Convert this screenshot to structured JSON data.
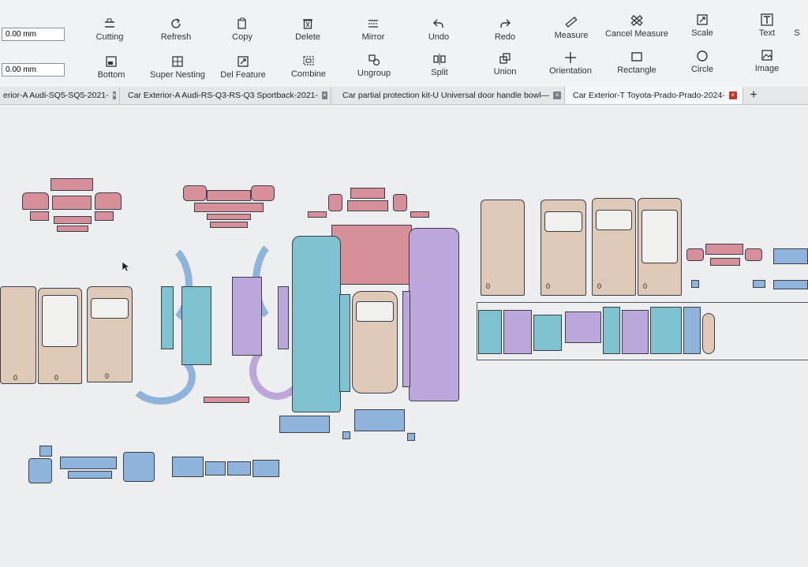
{
  "inputs": [
    {
      "value": "0.00 mm"
    },
    {
      "value": "0.00 mm"
    }
  ],
  "toolbar": {
    "row1": [
      {
        "label": "Cutting",
        "icon": "cutting-icon"
      },
      {
        "label": "Refresh",
        "icon": "refresh-icon"
      },
      {
        "label": "Copy",
        "icon": "copy-icon"
      },
      {
        "label": "Delete",
        "icon": "delete-icon"
      },
      {
        "label": "Mirror",
        "icon": "mirror-icon"
      },
      {
        "label": "Undo",
        "icon": "undo-icon"
      },
      {
        "label": "Redo",
        "icon": "redo-icon"
      },
      {
        "label": "Measure",
        "icon": "measure-icon"
      },
      {
        "label": "Cancel Measure",
        "icon": "cancel-measure-icon"
      },
      {
        "label": "Scale",
        "icon": "scale-icon"
      },
      {
        "label": "Text",
        "icon": "text-icon"
      },
      {
        "label": "S",
        "icon": ""
      }
    ],
    "row2": [
      {
        "label": "Bottom",
        "icon": "bottom-icon"
      },
      {
        "label": "Super Nesting",
        "icon": "super-nesting-icon"
      },
      {
        "label": "Del Feature",
        "icon": "del-feature-icon"
      },
      {
        "label": "Combine",
        "icon": "combine-icon"
      },
      {
        "label": "Ungroup",
        "icon": "ungroup-icon"
      },
      {
        "label": "Split",
        "icon": "split-icon"
      },
      {
        "label": "Union",
        "icon": "union-icon"
      },
      {
        "label": "Orientation",
        "icon": "orientation-icon"
      },
      {
        "label": "Rectangle",
        "icon": "rectangle-icon"
      },
      {
        "label": "Circle",
        "icon": "circle-icon"
      },
      {
        "label": "Image",
        "icon": "image-icon"
      }
    ]
  },
  "tabs": [
    {
      "label": "erior-A Audi-SQ5-SQ5-2021-",
      "active": false
    },
    {
      "label": "Car Exterior-A Audi-RS-Q3-RS-Q3 Sportback-2021-",
      "active": false
    },
    {
      "label": "Car partial protection kit-U Universal door handle bowl—",
      "active": false
    },
    {
      "label": "Car Exterior-T Toyota-Prado-Prado-2024-",
      "active": true
    }
  ],
  "tab_close_symbol": "×",
  "new_tab_symbol": "+",
  "door_panel_mark": "0",
  "colors": {
    "beige": "#ddc9b6",
    "pink": "#d78f9a",
    "blue": "#8fb4dc",
    "teal": "#7fc2cf",
    "purple": "#bba7d9"
  }
}
